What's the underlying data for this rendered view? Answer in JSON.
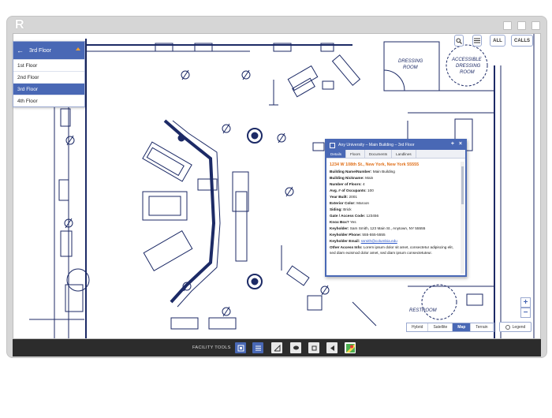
{
  "app": {
    "logo": "R"
  },
  "floor_selector": {
    "current": "3rd Floor",
    "back_icon": "arrow-left-icon",
    "floors": [
      "1st Floor",
      "2nd Floor",
      "3rd Floor",
      "4th Floor"
    ],
    "active_index": 2
  },
  "top_controls": {
    "search_icon": "magnifier-icon",
    "list_icon": "list-icon",
    "all_label": "ALL",
    "calls_label": "CALLS"
  },
  "rooms": {
    "dressing": "DRESSING ROOM",
    "dressing_line1": "DRESSING",
    "dressing_line2": "ROOM",
    "accessible_line1": "ACCESSIBLE",
    "accessible_line2": "DRESSING",
    "accessible_line3": "ROOM",
    "restroom": "RESTROOM"
  },
  "popup": {
    "title": "Any University – Main Building – 3rd Floor",
    "expand_label": "+",
    "close_label": "×",
    "tabs": [
      "Details",
      "Floors",
      "Documents",
      "Landlines"
    ],
    "active_tab": 0,
    "address": "1234 W 108th St., New York, New York 55555",
    "fields": [
      {
        "label": "Building Name/Number:",
        "value": "Main Building"
      },
      {
        "label": "Building Nickname:",
        "value": "Main"
      },
      {
        "label": "Number of Floors:",
        "value": "4"
      },
      {
        "label": "Avg. # of Occupants:",
        "value": "100"
      },
      {
        "label": "Year Built:",
        "value": "2001"
      },
      {
        "label": "Exterior Color:",
        "value": "Maroon"
      },
      {
        "label": "Siding:",
        "value": "Brick"
      },
      {
        "label": "Gate / Access Code:",
        "value": "123456"
      },
      {
        "label": "Knox Box?",
        "value": "Yes"
      },
      {
        "label": "Keyholder:",
        "value": "Sam Smith, 123 Main St., Anytown, NY 55555"
      },
      {
        "label": "Keyholder Phone:",
        "value": "555-555-5555"
      },
      {
        "label": "Keyholder Email:",
        "value": "ssmith@columbia.edu",
        "link": true
      },
      {
        "label": "Other Access Info:",
        "value": "Lorem ipsum dolor sit amet, consectetur adipiscing elit, sed diam euismod dolor amet, sed diam ipsum consectetuteur."
      }
    ]
  },
  "zoom": {
    "in": "+",
    "out": "−"
  },
  "map_types": [
    "Hybrid",
    "Satellite",
    "Map",
    "Terrain"
  ],
  "active_map_type": 2,
  "legend_label": "Legend",
  "toolbar": {
    "label": "FACILITY TOOLS",
    "tools": [
      "building-icon",
      "layers-icon",
      "measure-icon",
      "comment-icon",
      "square-icon",
      "collapse-icon",
      "google-maps-icon"
    ]
  }
}
